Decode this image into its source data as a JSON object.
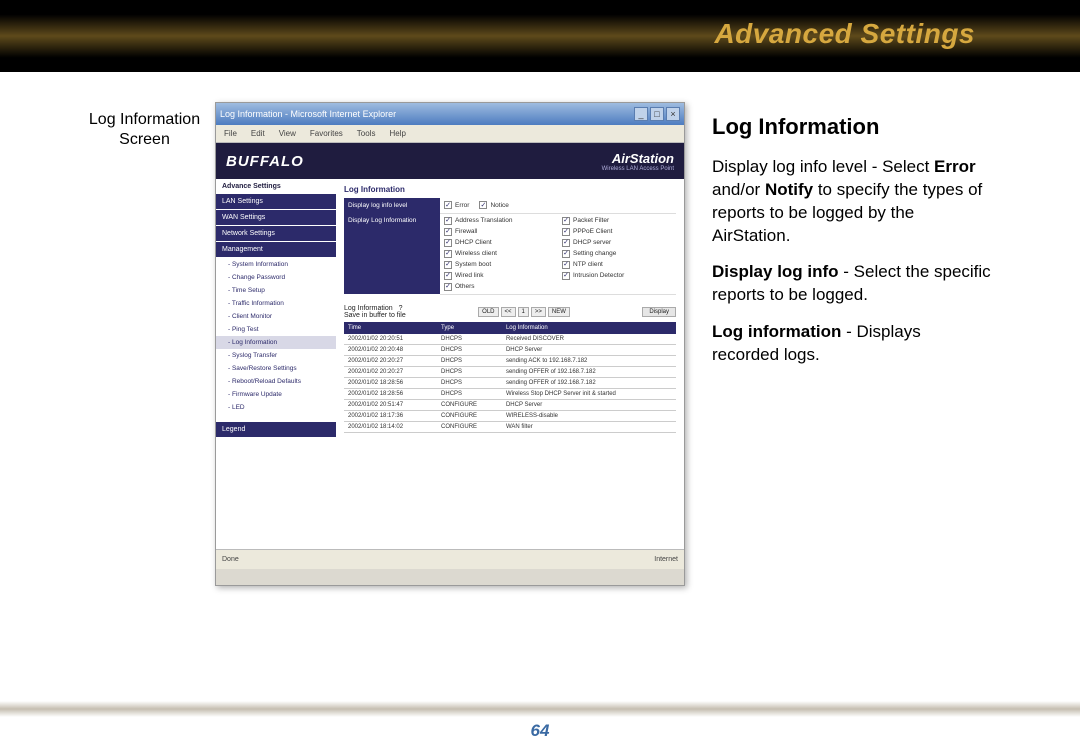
{
  "header": {
    "title": "Advanced Settings"
  },
  "caption": "Log Information Screen",
  "window": {
    "title": "Log Information - Microsoft Internet Explorer",
    "menu": [
      "File",
      "Edit",
      "View",
      "Favorites",
      "Tools",
      "Help"
    ],
    "brand_left": "BUFFALO",
    "brand_right_big": "AirStation",
    "brand_right_small": "Wireless LAN Access Point",
    "sidebar_heading": "Advance Settings",
    "sidebar_main": [
      "LAN Settings",
      "WAN Settings",
      "Network Settings",
      "Management"
    ],
    "sidebar_sub": [
      "System Information",
      "Change Password",
      "Time Setup",
      "Traffic Information",
      "Client Monitor",
      "Ping Test",
      "Log Information",
      "Syslog Transfer",
      "Save/Restore Settings",
      "Reboot/Reload Defaults",
      "Firmware Update",
      "LED"
    ],
    "sidebar_legend": "Legend",
    "main_title": "Log Information",
    "row1_label": "Display log info level",
    "row1_checks": [
      {
        "label": "Error",
        "checked": true
      },
      {
        "label": "Notice",
        "checked": true
      }
    ],
    "row2_label": "Display Log Information",
    "row2_checks": [
      {
        "label": "Address Translation",
        "checked": true
      },
      {
        "label": "Packet Filter",
        "checked": true
      },
      {
        "label": "Firewall",
        "checked": true
      },
      {
        "label": "PPPoE Client",
        "checked": true
      },
      {
        "label": "DHCP Client",
        "checked": true
      },
      {
        "label": "DHCP server",
        "checked": true
      },
      {
        "label": "Wireless client",
        "checked": true
      },
      {
        "label": "Setting change",
        "checked": true
      },
      {
        "label": "System boot",
        "checked": true
      },
      {
        "label": "NTP client",
        "checked": true
      },
      {
        "label": "Wired link",
        "checked": true
      },
      {
        "label": "Intrusion Detector",
        "checked": true
      },
      {
        "label": "Others",
        "checked": true
      }
    ],
    "log_section_label": "Log Information",
    "log_sub": "Save in buffer to file",
    "pager": [
      "OLD",
      "<<",
      "1",
      ">>",
      "NEW"
    ],
    "display_btn": "Display",
    "columns": [
      "Time",
      "Type",
      "Log Information"
    ],
    "rows": [
      {
        "time": "2002/01/02 20:20:51",
        "type": "DHCPS",
        "info": "Received DISCOVER"
      },
      {
        "time": "2002/01/02 20:20:48",
        "type": "DHCPS",
        "info": "DHCP Server"
      },
      {
        "time": "2002/01/02 20:20:27",
        "type": "DHCPS",
        "info": "sending ACK to 192.168.7.182"
      },
      {
        "time": "2002/01/02 20:20:27",
        "type": "DHCPS",
        "info": "sending OFFER of 192.168.7.182"
      },
      {
        "time": "2002/01/02 18:28:56",
        "type": "DHCPS",
        "info": "sending OFFER of 192.168.7.182"
      },
      {
        "time": "2002/01/02 18:28:56",
        "type": "DHCPS",
        "info": "Wireless Stop DHCP Server init & started"
      },
      {
        "time": "2002/01/02 20:51:47",
        "type": "CONFIGURE",
        "info": "DHCP Server"
      },
      {
        "time": "2002/01/02 18:17:36",
        "type": "CONFIGURE",
        "info": "WIRELESS-disable"
      },
      {
        "time": "2002/01/02 18:14:02",
        "type": "CONFIGURE",
        "info": "WAN filter"
      }
    ],
    "status_left": "Done",
    "status_right": "Internet"
  },
  "desc": {
    "heading": "Log Information",
    "p1a": "Display log info level - Select ",
    "p1b": "Error",
    "p1c": " and/or ",
    "p1d": "Notify",
    "p1e": " to specify the types of reports to be logged by the AirStation.",
    "p2a": "Display log info",
    "p2b": " - Select the specific reports to be logged.",
    "p3a": "Log information",
    "p3b": " - Displays recorded logs."
  },
  "page_number": "64"
}
